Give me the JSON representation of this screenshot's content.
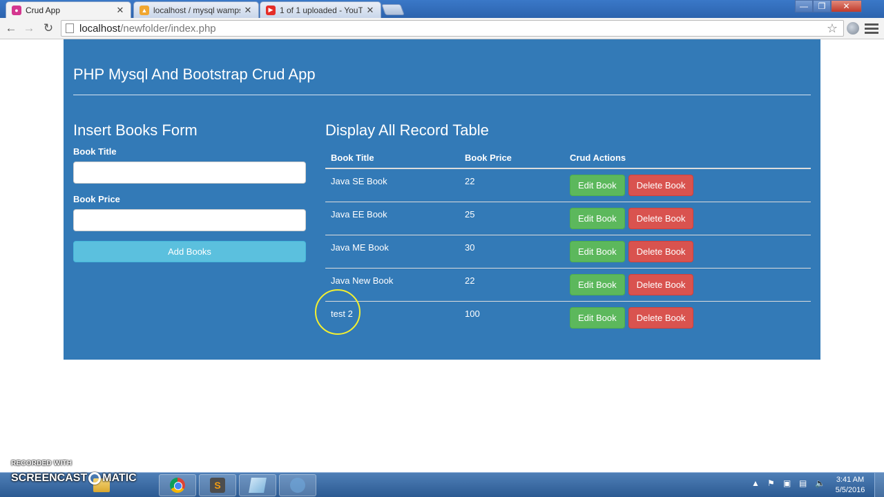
{
  "browser": {
    "tabs": [
      {
        "title": "Crud App",
        "active": true
      },
      {
        "title": "localhost / mysql wampse",
        "active": false
      },
      {
        "title": "1 of 1 uploaded - YouTube",
        "active": false
      }
    ],
    "url_host": "localhost",
    "url_path": "/newfolder/index.php"
  },
  "app": {
    "title": "PHP Mysql And Bootstrap Crud App",
    "form": {
      "heading": "Insert Books Form",
      "title_label": "Book Title",
      "title_value": "",
      "price_label": "Book Price",
      "price_value": "",
      "submit_label": "Add Books"
    },
    "table": {
      "heading": "Display All Record Table",
      "columns": [
        "Book Title",
        "Book Price",
        "Crud Actions"
      ],
      "rows": [
        {
          "title": "Java SE Book",
          "price": "22"
        },
        {
          "title": "Java EE Book",
          "price": "25"
        },
        {
          "title": "Java ME Book",
          "price": "30"
        },
        {
          "title": "Java New Book",
          "price": "22"
        },
        {
          "title": "test 2",
          "price": "100"
        }
      ],
      "edit_label": "Edit Book",
      "delete_label": "Delete Book"
    }
  },
  "watermark": {
    "line1": "RECORDED WITH",
    "part1": "SCREENCAST",
    "part2": "MATIC"
  },
  "taskbar": {
    "time": "3:41 AM",
    "date": "5/5/2016"
  },
  "colors": {
    "panel": "#337ab7",
    "edit": "#5cb85c",
    "delete": "#d9534f",
    "add": "#5bc0de"
  }
}
